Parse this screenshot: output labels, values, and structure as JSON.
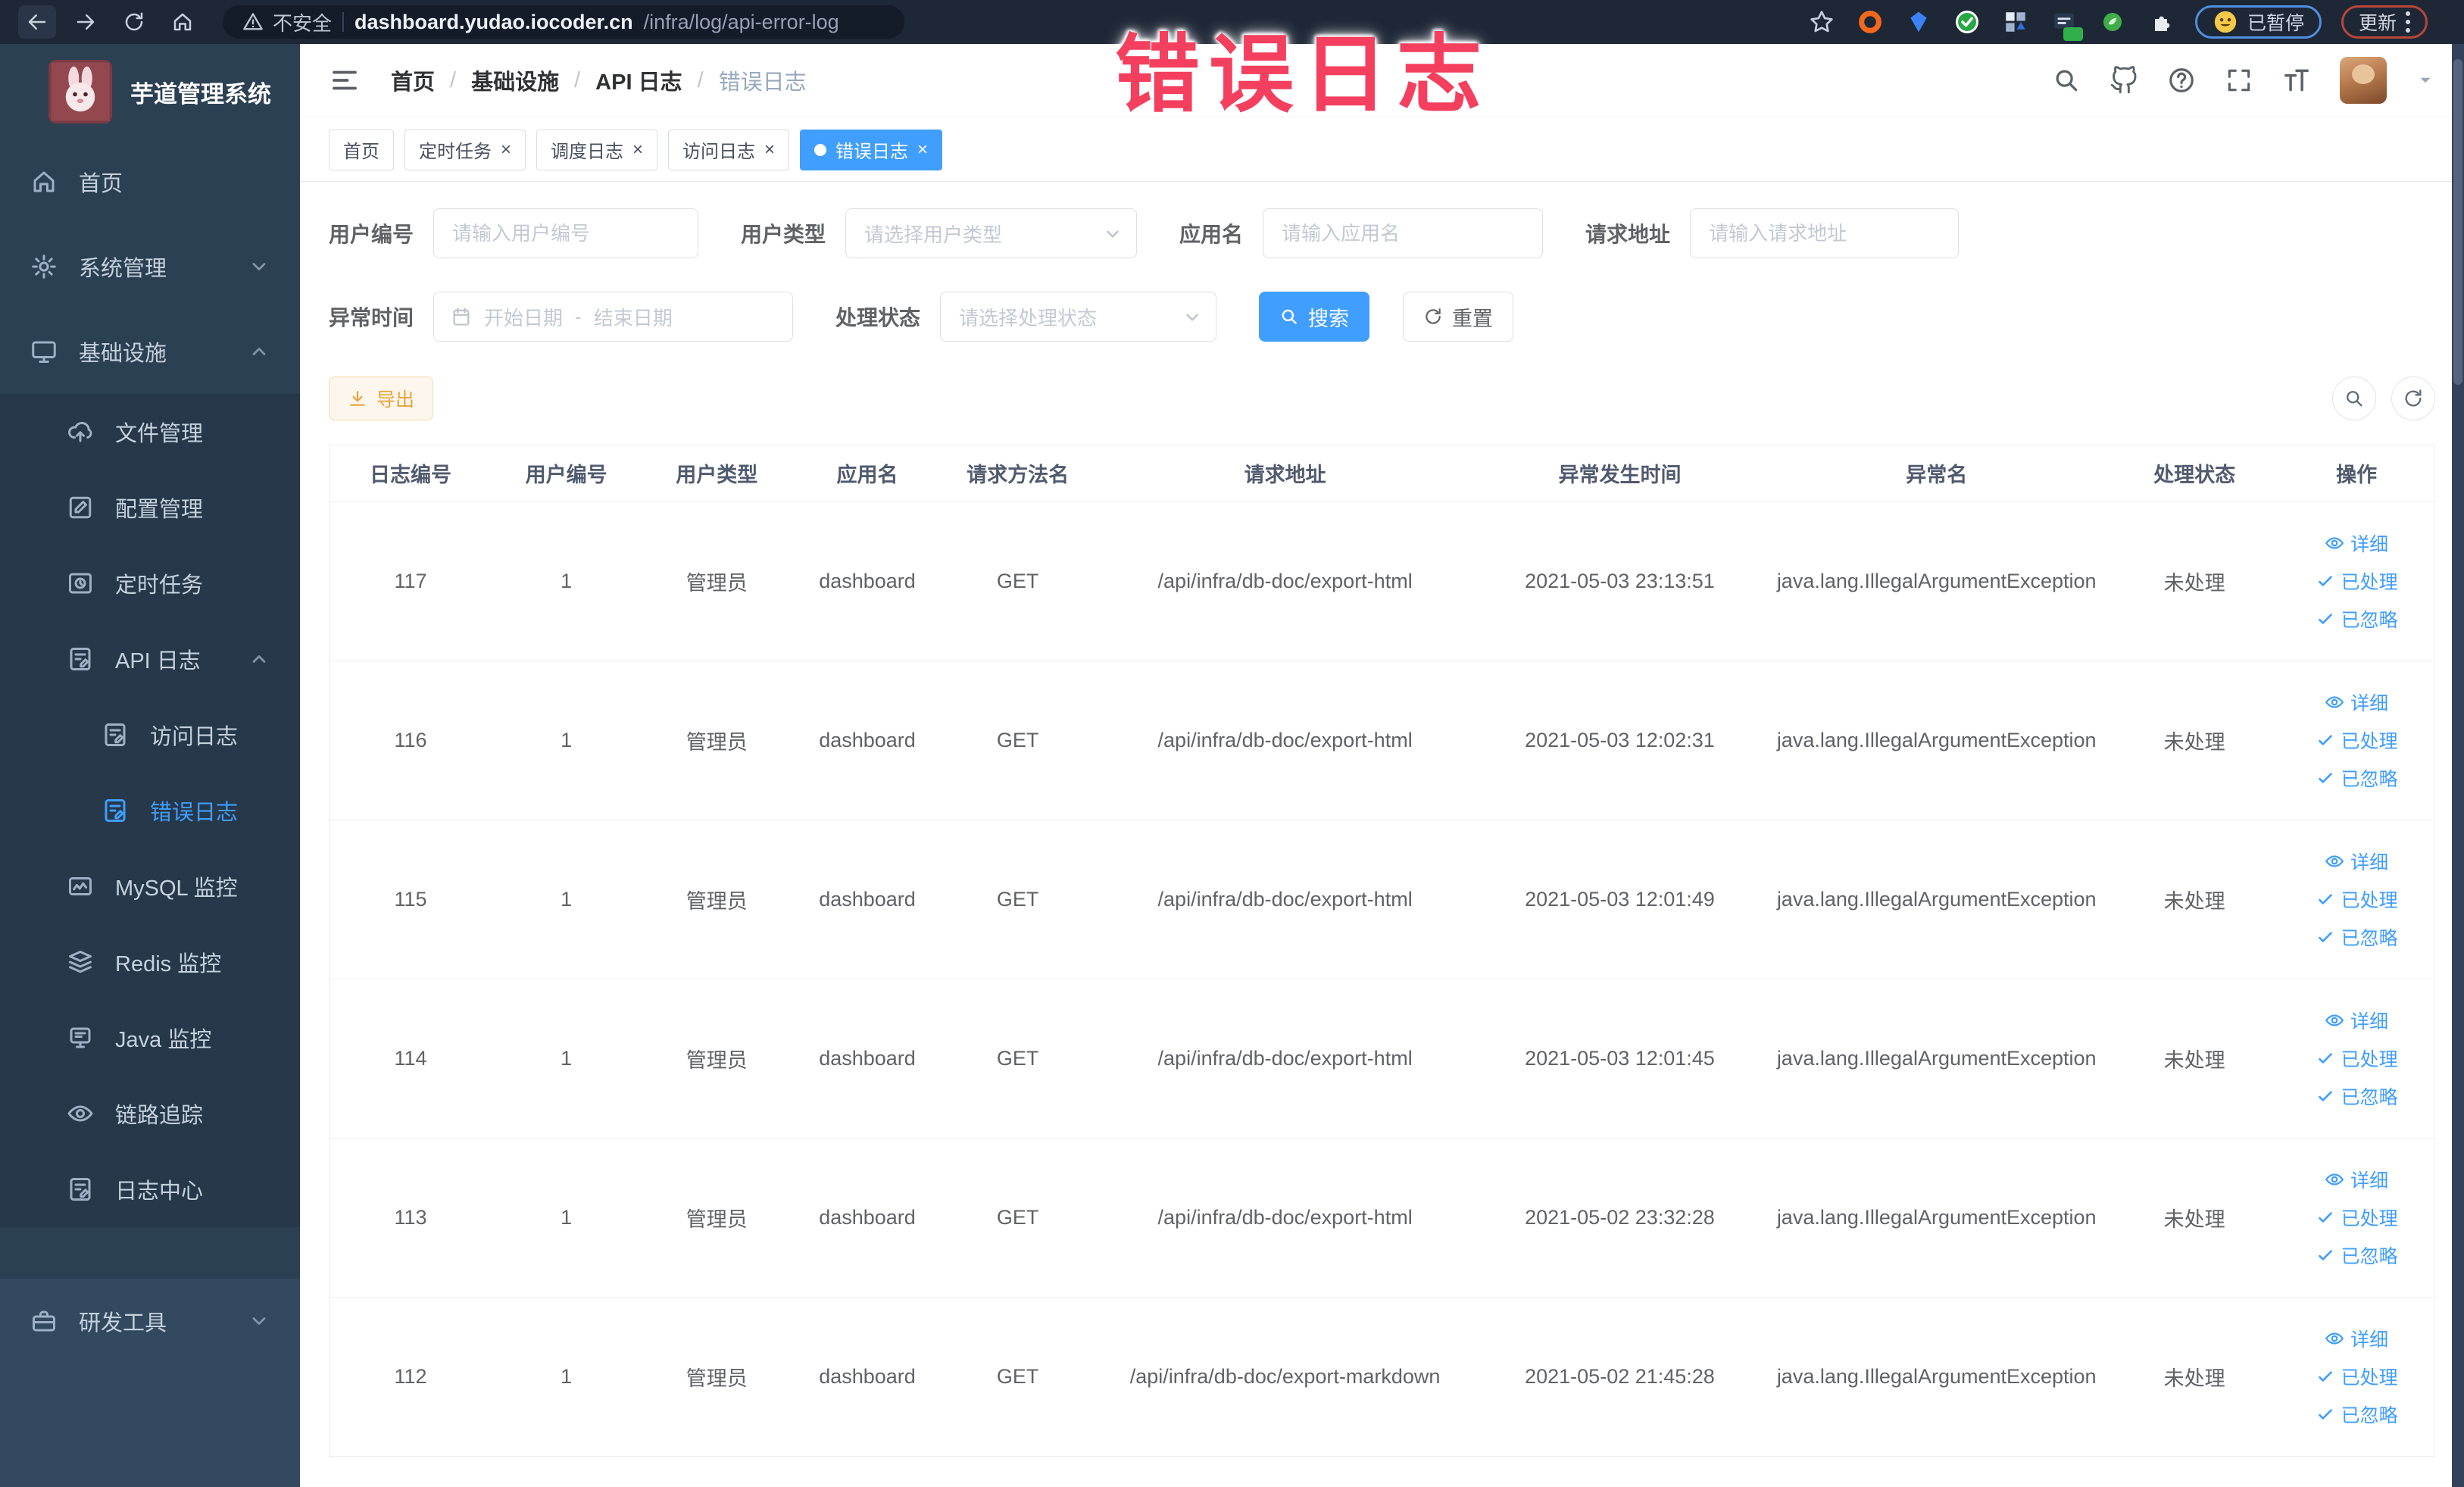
{
  "browser": {
    "security_label": "不安全",
    "url_host": "dashboard.yudao.iocoder.cn",
    "url_path": "/infra/log/api-error-log",
    "paused_badge": "已暂停",
    "update_button": "更新"
  },
  "watermark": "错误日志",
  "sidebar": {
    "title": "芋道管理系统",
    "items": [
      {
        "label": "首页",
        "icon": "home-icon"
      },
      {
        "label": "系统管理",
        "icon": "gear-icon",
        "chevron": "down"
      },
      {
        "label": "基础设施",
        "icon": "monitor-icon",
        "chevron": "up"
      },
      {
        "label": "文件管理",
        "icon": "upload-cloud-icon"
      },
      {
        "label": "配置管理",
        "icon": "edit-icon"
      },
      {
        "label": "定时任务",
        "icon": "timer-icon"
      },
      {
        "label": "API 日志",
        "icon": "log-icon",
        "chevron": "up"
      },
      {
        "label": "访问日志",
        "icon": "log-icon"
      },
      {
        "label": "错误日志",
        "icon": "log-icon",
        "active": true
      },
      {
        "label": "MySQL 监控",
        "icon": "mysql-icon"
      },
      {
        "label": "Redis 监控",
        "icon": "redis-icon"
      },
      {
        "label": "Java 监控",
        "icon": "java-icon"
      },
      {
        "label": "链路追踪",
        "icon": "trace-eye-icon"
      },
      {
        "label": "日志中心",
        "icon": "log-icon"
      },
      {
        "label": "研发工具",
        "icon": "toolbox-icon",
        "chevron": "down"
      }
    ]
  },
  "header": {
    "breadcrumb": [
      "首页",
      "基础设施",
      "API 日志",
      "错误日志"
    ],
    "separator": "/"
  },
  "tabs": [
    {
      "label": "首页",
      "closable": false,
      "active": false
    },
    {
      "label": "定时任务",
      "closable": true,
      "active": false
    },
    {
      "label": "调度日志",
      "closable": true,
      "active": false
    },
    {
      "label": "访问日志",
      "closable": true,
      "active": false
    },
    {
      "label": "错误日志",
      "closable": true,
      "active": true
    }
  ],
  "filters": {
    "user_id": {
      "label": "用户编号",
      "placeholder": "请输入用户编号"
    },
    "user_type": {
      "label": "用户类型",
      "placeholder": "请选择用户类型"
    },
    "app_name": {
      "label": "应用名",
      "placeholder": "请输入应用名"
    },
    "request_url": {
      "label": "请求地址",
      "placeholder": "请输入请求地址"
    },
    "exception_time": {
      "label": "异常时间",
      "start_placeholder": "开始日期",
      "separator": "-",
      "end_placeholder": "结束日期"
    },
    "process_status": {
      "label": "处理状态",
      "placeholder": "请选择处理状态"
    },
    "search_label": "搜索",
    "reset_label": "重置"
  },
  "toolbar": {
    "export_label": "导出"
  },
  "table": {
    "columns": [
      "日志编号",
      "用户编号",
      "用户类型",
      "应用名",
      "请求方法名",
      "请求地址",
      "异常发生时间",
      "异常名",
      "处理状态",
      "操作"
    ],
    "action_labels": {
      "detail": "详细",
      "processed": "已处理",
      "ignored": "已忽略"
    },
    "rows": [
      {
        "id": "117",
        "user_id": "1",
        "user_type": "管理员",
        "app": "dashboard",
        "method": "GET",
        "url": "/api/infra/db-doc/export-html",
        "time": "2021-05-03 23:13:51",
        "exception": "java.lang.IllegalArgumentException",
        "status": "未处理"
      },
      {
        "id": "116",
        "user_id": "1",
        "user_type": "管理员",
        "app": "dashboard",
        "method": "GET",
        "url": "/api/infra/db-doc/export-html",
        "time": "2021-05-03 12:02:31",
        "exception": "java.lang.IllegalArgumentException",
        "status": "未处理"
      },
      {
        "id": "115",
        "user_id": "1",
        "user_type": "管理员",
        "app": "dashboard",
        "method": "GET",
        "url": "/api/infra/db-doc/export-html",
        "time": "2021-05-03 12:01:49",
        "exception": "java.lang.IllegalArgumentException",
        "status": "未处理"
      },
      {
        "id": "114",
        "user_id": "1",
        "user_type": "管理员",
        "app": "dashboard",
        "method": "GET",
        "url": "/api/infra/db-doc/export-html",
        "time": "2021-05-03 12:01:45",
        "exception": "java.lang.IllegalArgumentException",
        "status": "未处理"
      },
      {
        "id": "113",
        "user_id": "1",
        "user_type": "管理员",
        "app": "dashboard",
        "method": "GET",
        "url": "/api/infra/db-doc/export-html",
        "time": "2021-05-02 23:32:28",
        "exception": "java.lang.IllegalArgumentException",
        "status": "未处理"
      },
      {
        "id": "112",
        "user_id": "1",
        "user_type": "管理员",
        "app": "dashboard",
        "method": "GET",
        "url": "/api/infra/db-doc/export-markdown",
        "time": "2021-05-02 21:45:28",
        "exception": "java.lang.IllegalArgumentException",
        "status": "未处理"
      }
    ]
  },
  "colors": {
    "accent": "#409eff",
    "warning": "#e6a23c",
    "watermark": "#f43f5e",
    "sidebar_bg": "#2c4053",
    "browser_bar_bg": "#1e2736"
  }
}
